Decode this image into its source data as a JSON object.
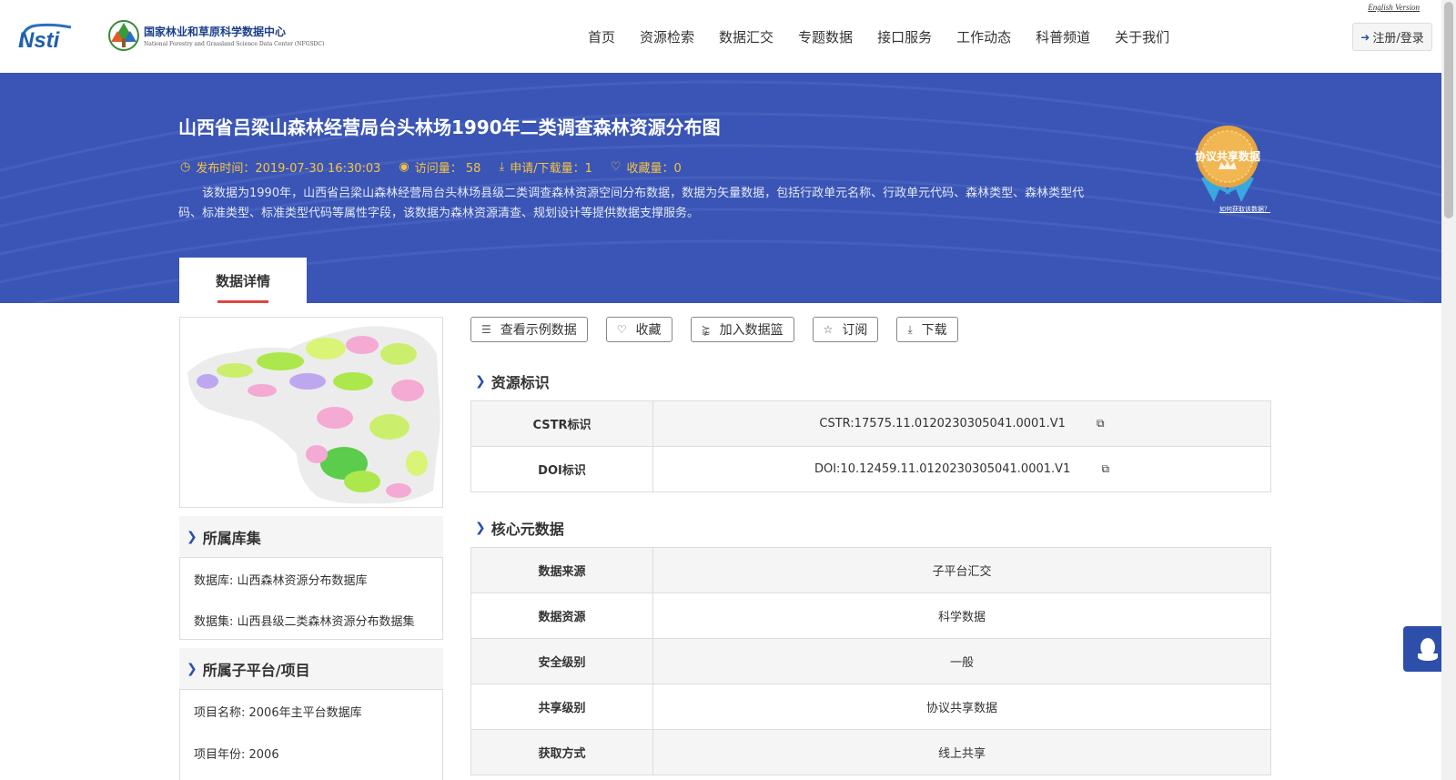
{
  "header": {
    "logo_nsti": "Nsti",
    "center_name_cn": "国家林业和草原科学数据中心",
    "center_name_en": "National Forestry and Grassland Science Data Center (NFGSDC)",
    "english_link": "English Version",
    "nav": [
      "首页",
      "资源检索",
      "数据汇交",
      "专题数据",
      "接口服务",
      "工作动态",
      "科普频道",
      "关于我们"
    ],
    "login_label": "注册/登录"
  },
  "banner": {
    "title": "山西省吕梁山森林经营局台头林场1990年二类调查森林资源分布图",
    "meta": {
      "publish_time": "发布时间：2019-07-30 16:30:03",
      "visits": "访问量： 58",
      "downloads": "申请/下载量：1",
      "favorites": "收藏量：0"
    },
    "description": "该数据为1990年，山西省吕梁山森林经营局台头林场县级二类调查森林资源空间分布数据，数据为矢量数据，包括行政单元名称、行政单元代码、森林类型、森林类型代码、标准类型、标准类型代码等属性字段，该数据为森林资源清查、规划设计等提供数据支撑服务。",
    "badge_text": "协议共享数据",
    "badge_link": "如何获取该数据？",
    "tab_label": "数据详情"
  },
  "left": {
    "library_head": "所属库集",
    "database": "数据库: 山西森林资源分布数据库",
    "dataset": "数据集: 山西县级二类森林资源分布数据集",
    "project_head": "所属子平台/项目",
    "project_name": "项目名称: 2006年主平台数据库",
    "project_year": "项目年份: 2006"
  },
  "actions": {
    "view_sample": "查看示例数据",
    "favorite": "收藏",
    "add_basket": "加入数据篮",
    "subscribe": "订阅",
    "download": "下载"
  },
  "resource_id": {
    "head": "资源标识",
    "rows": [
      {
        "key": "CSTR标识",
        "value": "CSTR:17575.11.0120230305041.0001.V1"
      },
      {
        "key": "DOI标识",
        "value": "DOI:10.12459.11.0120230305041.0001.V1"
      }
    ]
  },
  "core_meta": {
    "head": "核心元数据",
    "rows": [
      {
        "key": "数据来源",
        "value": "子平台汇交"
      },
      {
        "key": "数据资源",
        "value": "科学数据"
      },
      {
        "key": "安全级别",
        "value": "一般"
      },
      {
        "key": "共享级别",
        "value": "协议共享数据"
      },
      {
        "key": "获取方式",
        "value": "线上共享"
      }
    ]
  },
  "colors": {
    "banner": "#3a55b5",
    "accent": "#2d4ea9",
    "meta_text": "#f5c342",
    "tab_underline": "#e0463c"
  }
}
